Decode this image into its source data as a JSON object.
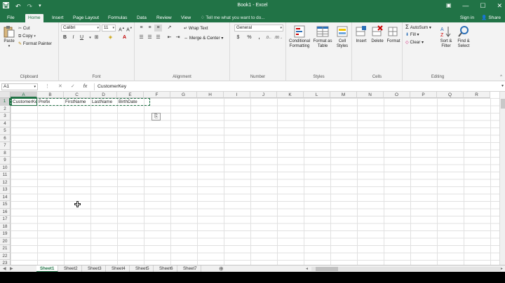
{
  "window": {
    "title": "Book1 - Excel",
    "ribbon_display_icon": "ribbon-display-options-icon",
    "signin": "Sign in",
    "share": "Share"
  },
  "tabs": [
    "File",
    "Home",
    "Insert",
    "Page Layout",
    "Formulas",
    "Data",
    "Review",
    "View"
  ],
  "active_tab": "Home",
  "tell_me": "Tell me what you want to do...",
  "clipboard": {
    "paste": "Paste",
    "cut": "Cut",
    "copy": "Copy",
    "format_painter": "Format Painter",
    "label": "Clipboard"
  },
  "font": {
    "name": "Calibri",
    "size": "11",
    "label": "Font",
    "bold": "B",
    "italic": "I",
    "underline": "U"
  },
  "alignment": {
    "wrap_text": "Wrap Text",
    "merge_center": "Merge & Center",
    "label": "Alignment"
  },
  "number": {
    "format": "General",
    "label": "Number",
    "currency": "$",
    "percent": "%",
    "comma": ","
  },
  "styles": {
    "conditional": "Conditional Formatting",
    "format_table": "Format as Table",
    "cell_styles": "Cell Styles",
    "label": "Styles"
  },
  "cells": {
    "insert": "Insert",
    "delete": "Delete",
    "format": "Format",
    "label": "Cells"
  },
  "editing": {
    "autosum": "AutoSum",
    "fill": "Fill",
    "clear": "Clear",
    "sort_filter": "Sort & Filter",
    "find_select": "Find & Select",
    "label": "Editing"
  },
  "formula_bar": {
    "name_box": "A1",
    "content": "CustomerKey",
    "fx": "fx"
  },
  "grid": {
    "columns": [
      "A",
      "B",
      "C",
      "D",
      "E",
      "F",
      "G",
      "H",
      "I",
      "J",
      "K",
      "L",
      "M",
      "N",
      "O",
      "P",
      "Q",
      "R"
    ],
    "rows": [
      "1",
      "2",
      "3",
      "4",
      "5",
      "6",
      "7",
      "8",
      "9",
      "10",
      "11",
      "12",
      "13",
      "14",
      "15",
      "16",
      "17",
      "18",
      "19",
      "20",
      "21",
      "22",
      "23"
    ],
    "row1": [
      "CustomerKey",
      "Prefix",
      "FirstName",
      "LastName",
      "BirthDate"
    ],
    "selected_col": "A",
    "selected_row": "1"
  },
  "sheets": [
    "Sheet1",
    "Sheet2",
    "Sheet3",
    "Sheet4",
    "Sheet5",
    "Sheet6",
    "Sheet7"
  ],
  "active_sheet": "Sheet1",
  "colors": {
    "brand": "#217346",
    "ribbon_bg": "#f3f3f3"
  }
}
